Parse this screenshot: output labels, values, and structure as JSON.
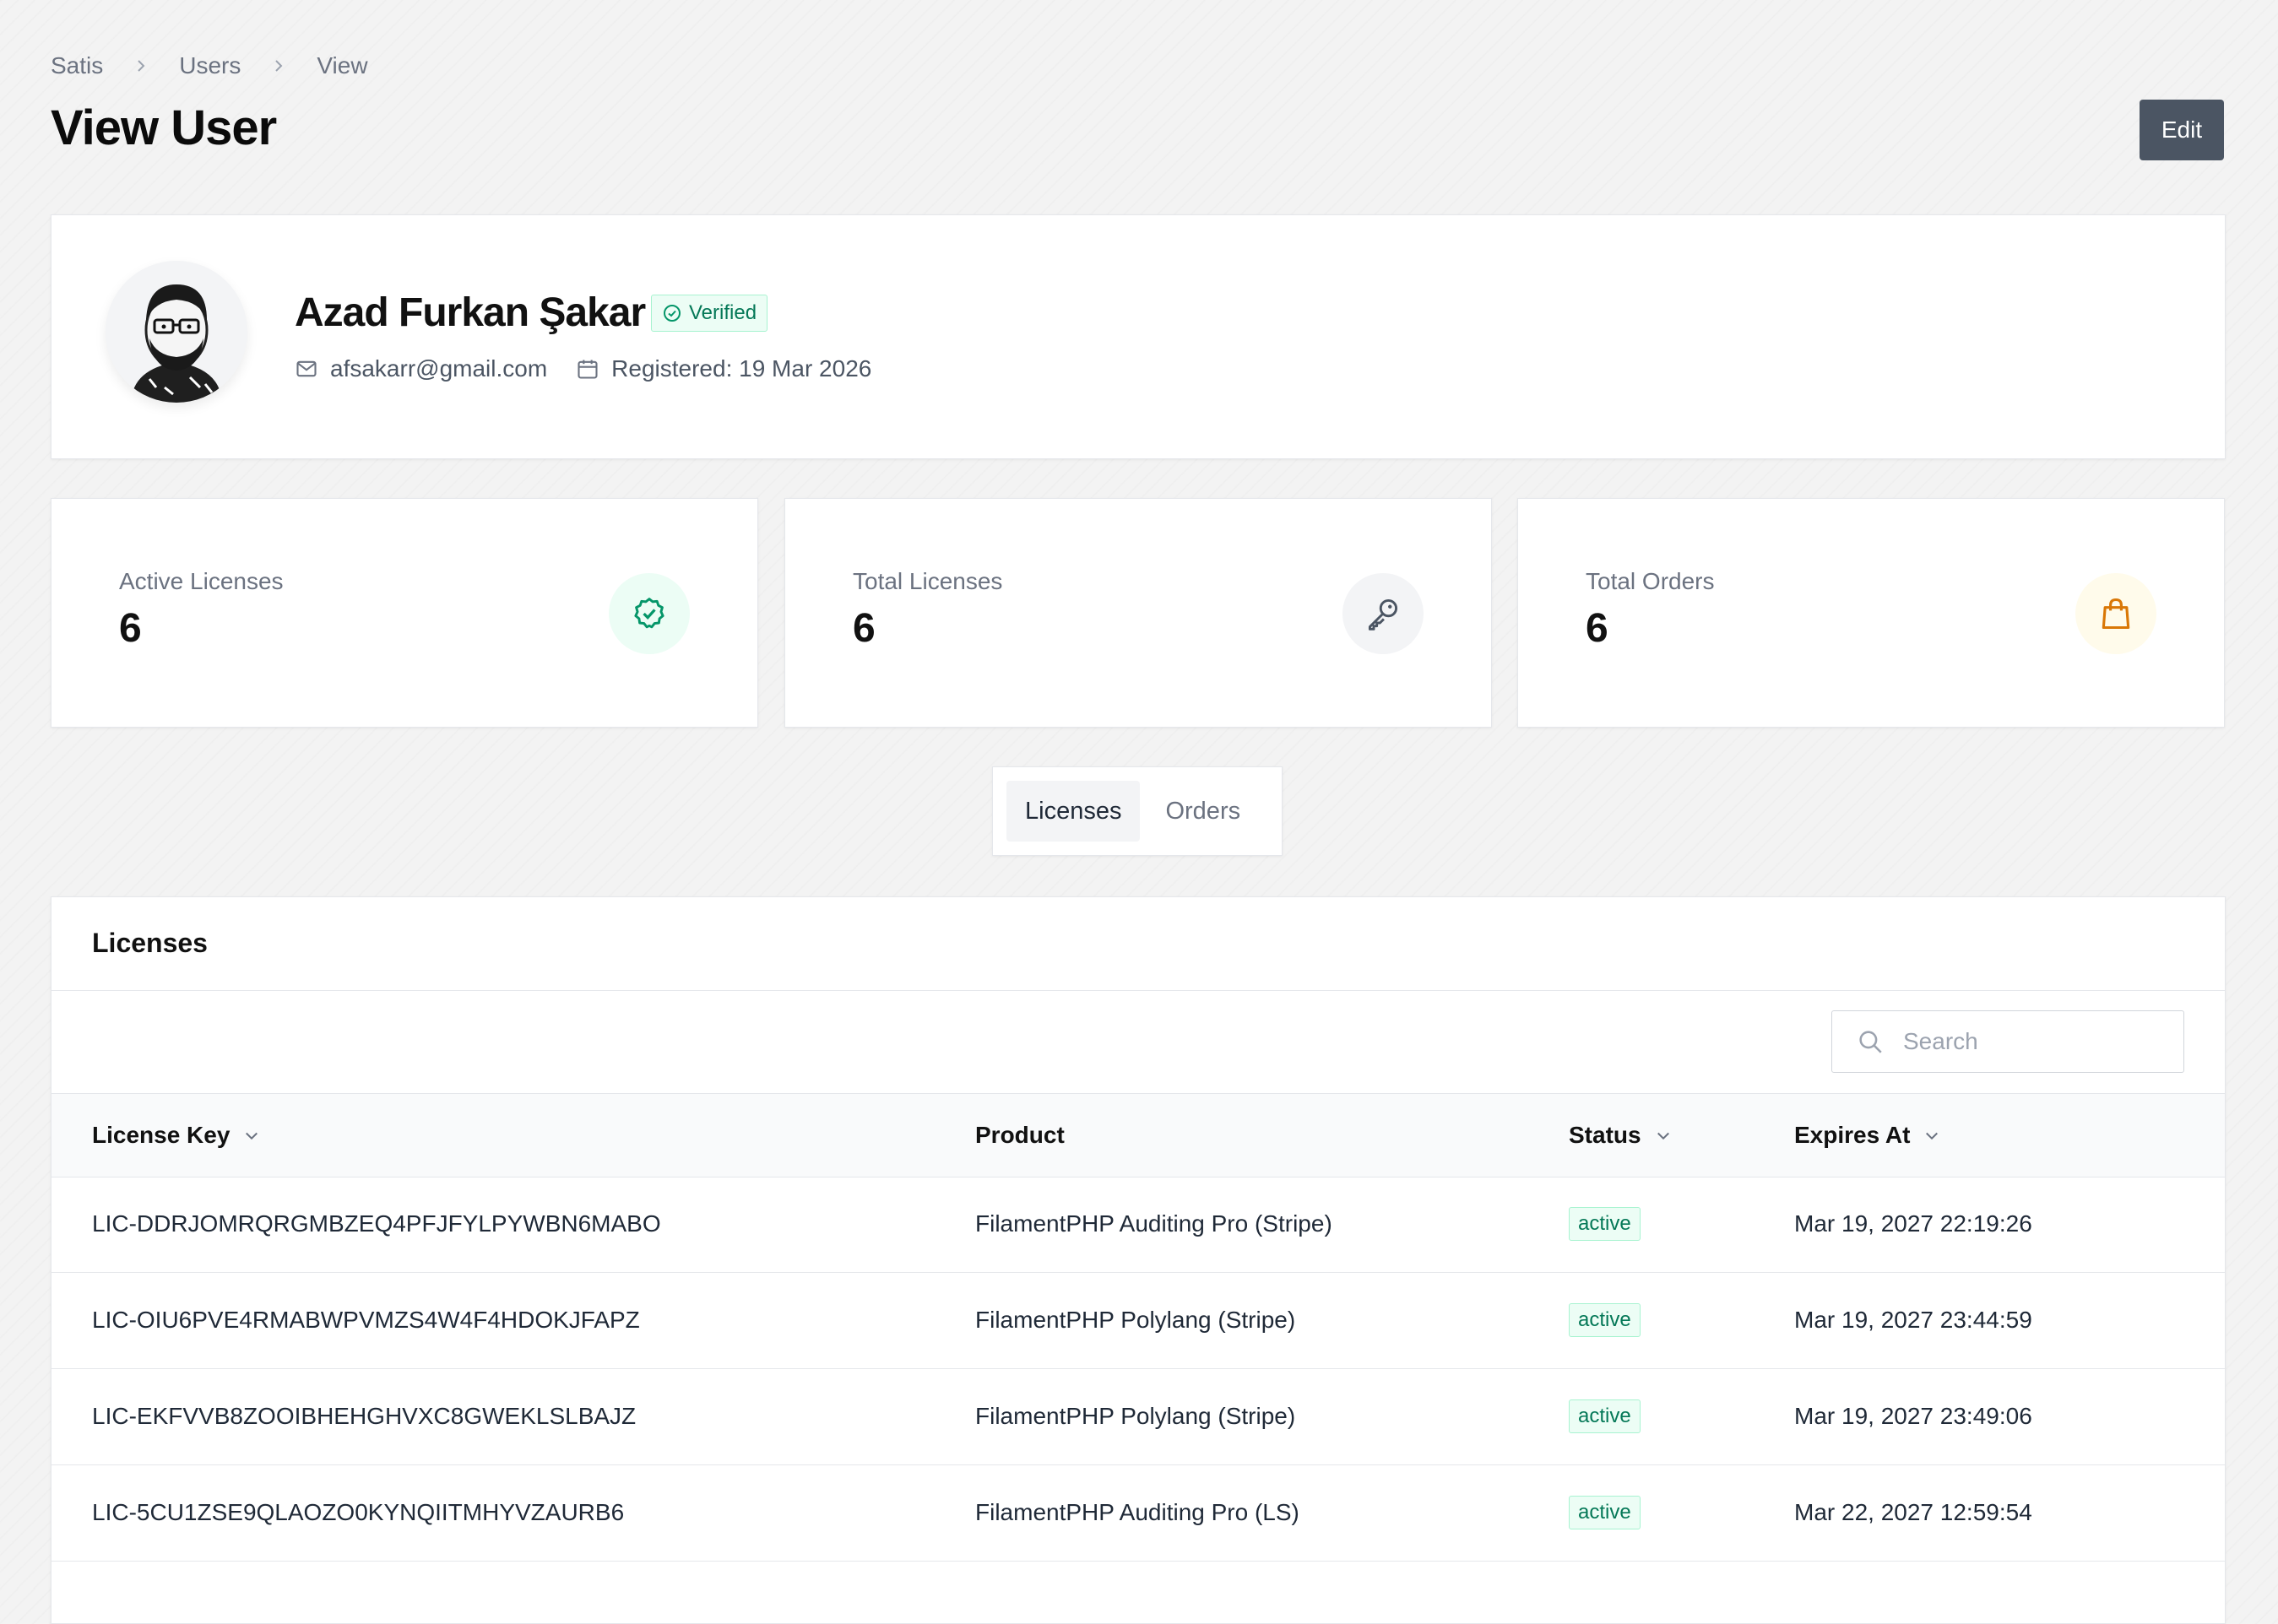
{
  "breadcrumb": [
    "Satis",
    "Users",
    "View"
  ],
  "page": {
    "title": "View User",
    "edit_label": "Edit"
  },
  "user": {
    "name": "Azad Furkan Şakar",
    "verified_label": "Verified",
    "email": "afsakarr@gmail.com",
    "registered": "Registered: 19 Mar 2026"
  },
  "stats": [
    {
      "label": "Active Licenses",
      "value": "6",
      "icon": "badge-check-icon",
      "color": "#059669",
      "bg": "#ecfdf5"
    },
    {
      "label": "Total Licenses",
      "value": "6",
      "icon": "key-icon",
      "color": "#4b5563",
      "bg": "#f3f4f6"
    },
    {
      "label": "Total Orders",
      "value": "6",
      "icon": "shopping-bag-icon",
      "color": "#d97706",
      "bg": "#fffbeb"
    }
  ],
  "tabs": [
    {
      "label": "Licenses",
      "active": true
    },
    {
      "label": "Orders",
      "active": false
    }
  ],
  "table": {
    "heading": "Licenses",
    "search_placeholder": "Search",
    "columns": [
      "License Key",
      "Product",
      "Status",
      "Expires At"
    ],
    "rows": [
      {
        "key": "LIC-DDRJOMRQRGMBZEQ4PFJFYLPYWBN6MABO",
        "product": "FilamentPHP Auditing Pro (Stripe)",
        "status": "active",
        "expires": "Mar 19, 2027 22:19:26"
      },
      {
        "key": "LIC-OIU6PVE4RMABWPVMZS4W4F4HDOKJFAPZ",
        "product": "FilamentPHP Polylang (Stripe)",
        "status": "active",
        "expires": "Mar 19, 2027 23:44:59"
      },
      {
        "key": "LIC-EKFVVB8ZOOIBHEHGHVXC8GWEKLSLBAJZ",
        "product": "FilamentPHP Polylang (Stripe)",
        "status": "active",
        "expires": "Mar 19, 2027 23:49:06"
      },
      {
        "key": "LIC-5CU1ZSE9QLAOZO0KYNQIITMHYVZAURB6",
        "product": "FilamentPHP Auditing Pro (LS)",
        "status": "active",
        "expires": "Mar 22, 2027 12:59:54"
      }
    ]
  },
  "colors": {
    "accent": "#4b5563",
    "success": "#047857",
    "warning": "#d97706"
  }
}
